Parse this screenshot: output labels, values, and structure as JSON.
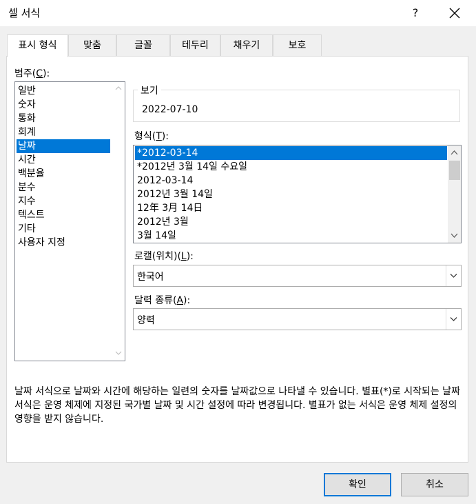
{
  "window": {
    "title": "셀 서식",
    "help": "?"
  },
  "tabs": [
    "표시 형식",
    "맞춤",
    "글꼴",
    "테두리",
    "채우기",
    "보호"
  ],
  "category": {
    "label": "범주(",
    "accel": "C",
    "suffix": "):",
    "items": [
      "일반",
      "숫자",
      "통화",
      "회계",
      "날짜",
      "시간",
      "백분율",
      "분수",
      "지수",
      "텍스트",
      "기타",
      "사용자 지정"
    ],
    "selected_index": 4
  },
  "sample": {
    "caption": "보기",
    "value": "2022-07-10"
  },
  "format": {
    "label": "형식(",
    "accel": "T",
    "suffix": "):",
    "items": [
      "*2012-03-14",
      "*2012년 3월 14일 수요일",
      "2012-03-14",
      "2012년 3월 14일",
      "12年 3月 14日",
      "2012년 3월",
      "3월 14일"
    ],
    "selected_index": 0
  },
  "locale": {
    "label": "로캘(위치)(",
    "accel": "L",
    "suffix": "):",
    "value": "한국어"
  },
  "calendar": {
    "label": "달력 종류(",
    "accel": "A",
    "suffix": "):",
    "value": "양력"
  },
  "description": "날짜 서식으로 날짜와 시간에 해당하는 일련의 숫자를 날짜값으로 나타낼 수 있습니다. 별표(*)로 시작되는 날짜 서식은 운영 체제에 지정된 국가별 날짜 및 시간 설정에 따라 변경됩니다. 별표가 없는 서식은 운영 체제 설정의 영향을 받지 않습니다.",
  "buttons": {
    "ok": "확인",
    "cancel": "취소"
  },
  "colors": {
    "selection": "#0078d7",
    "default_border": "#0078d7"
  }
}
